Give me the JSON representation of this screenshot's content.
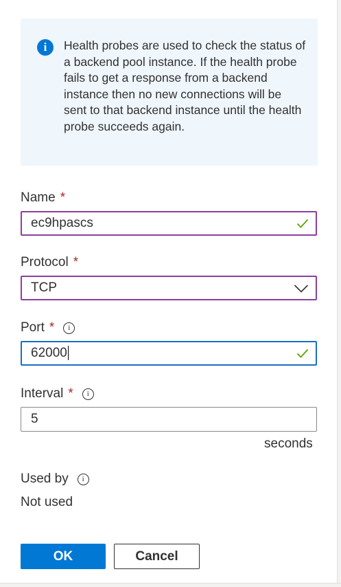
{
  "info": {
    "icon": "info-icon",
    "text": "Health probes are used to check the status of a backend pool instance. If the health probe fails to get a response from a backend instance then no new connections will be sent to that backend instance until the health probe succeeds again."
  },
  "fields": {
    "name": {
      "label": "Name",
      "required": "*",
      "value": "ec9hpascs",
      "valid": true
    },
    "protocol": {
      "label": "Protocol",
      "required": "*",
      "selected": "TCP"
    },
    "port": {
      "label": "Port",
      "required": "*",
      "value": "62000",
      "valid": true,
      "focused": true
    },
    "interval": {
      "label": "Interval",
      "required": "*",
      "value": "5",
      "unit": "seconds"
    },
    "used_by": {
      "label": "Used by",
      "value": "Not used"
    }
  },
  "buttons": {
    "ok": "OK",
    "cancel": "Cancel"
  },
  "colors": {
    "primary": "#0078d4",
    "required": "#a4262c",
    "valid_check": "#57a300",
    "input_border": "#8a3fa0",
    "focus_border": "#1b6ec2",
    "info_background": "#eff6fc"
  }
}
